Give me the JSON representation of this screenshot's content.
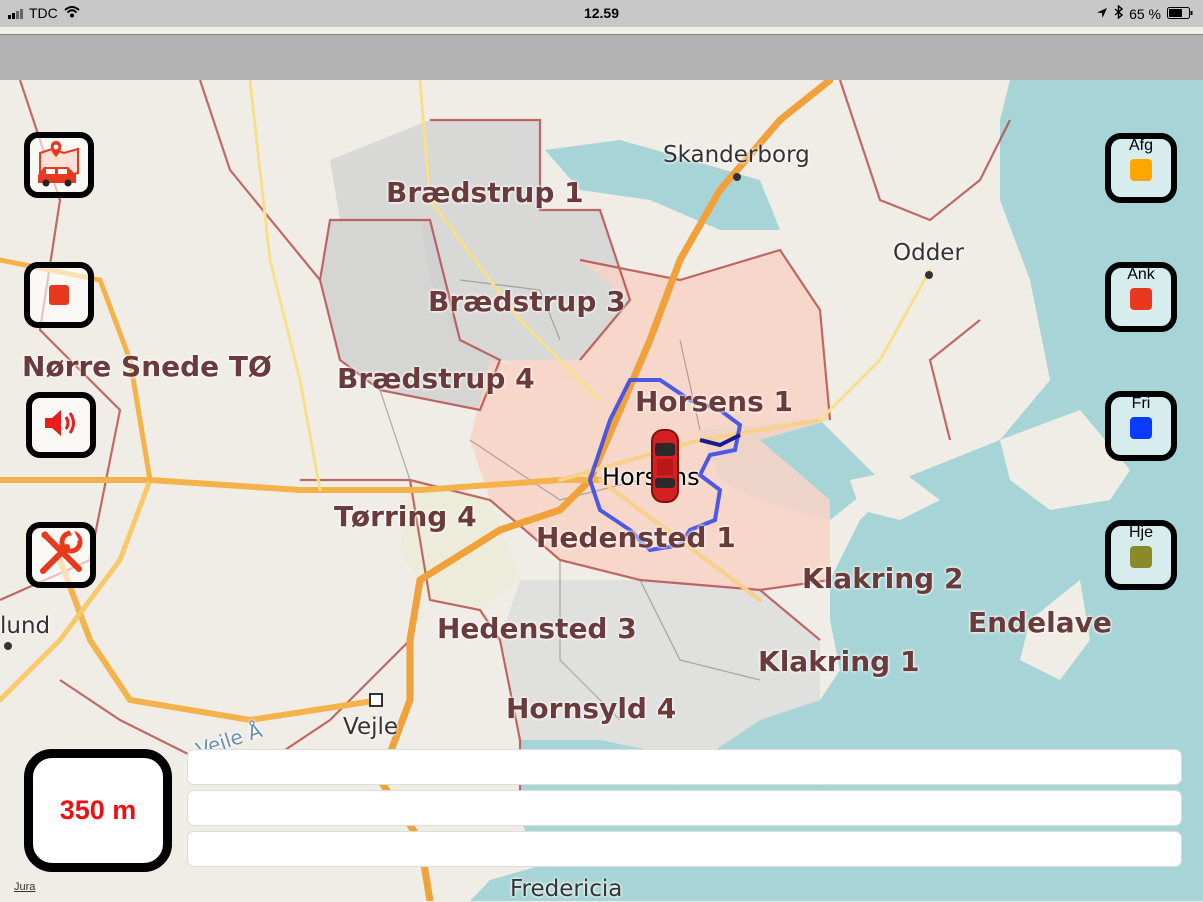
{
  "status_bar": {
    "carrier": "TDC",
    "time": "12.59",
    "battery": "65 %"
  },
  "map": {
    "district_labels": [
      "Brædstrup 1",
      "Brædstrup 3",
      "Brædstrup 4",
      "Nørre Snede TØ",
      "Horsens 1",
      "Tørring 4",
      "Hedensted 1",
      "Klakring 2",
      "Hedensted 3",
      "Endelave",
      "Klakring 1",
      "Hornsyld 4"
    ],
    "city_labels": [
      "Skanderborg",
      "Odder",
      "Horsens",
      "Vejle",
      "Fredericia",
      "lund"
    ],
    "river_label": "Vejle Å",
    "attribution": "Jura"
  },
  "left_buttons": [
    {
      "icon": "map-car-icon"
    },
    {
      "icon": "stop-icon",
      "color": "#e8381e"
    },
    {
      "icon": "speaker-icon",
      "color": "#e81e1e"
    },
    {
      "icon": "tools-icon",
      "color": "#e8381e"
    }
  ],
  "right_buttons": [
    {
      "label": "Afg",
      "color": "#ffa500"
    },
    {
      "label": "Ank",
      "color": "#e8381e"
    },
    {
      "label": "Fri",
      "color": "#0a3bff"
    },
    {
      "label": "Hje",
      "color": "#8a8a2a"
    }
  ],
  "distance": {
    "value": "350 m"
  },
  "info_bars": [
    "",
    "",
    ""
  ]
}
